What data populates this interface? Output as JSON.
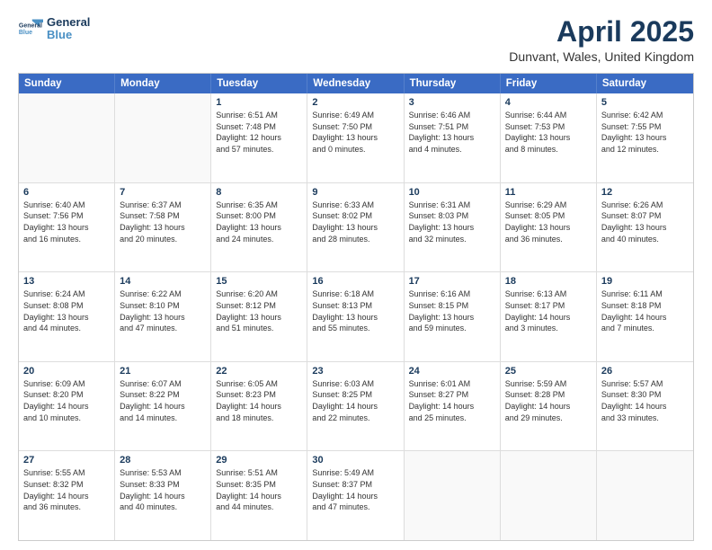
{
  "header": {
    "logo_line1": "General",
    "logo_line2": "Blue",
    "title": "April 2025",
    "subtitle": "Dunvant, Wales, United Kingdom"
  },
  "calendar": {
    "days_of_week": [
      "Sunday",
      "Monday",
      "Tuesday",
      "Wednesday",
      "Thursday",
      "Friday",
      "Saturday"
    ],
    "rows": [
      [
        {
          "day": "",
          "empty": true
        },
        {
          "day": "",
          "empty": true
        },
        {
          "day": "1",
          "line1": "Sunrise: 6:51 AM",
          "line2": "Sunset: 7:48 PM",
          "line3": "Daylight: 12 hours",
          "line4": "and 57 minutes."
        },
        {
          "day": "2",
          "line1": "Sunrise: 6:49 AM",
          "line2": "Sunset: 7:50 PM",
          "line3": "Daylight: 13 hours",
          "line4": "and 0 minutes."
        },
        {
          "day": "3",
          "line1": "Sunrise: 6:46 AM",
          "line2": "Sunset: 7:51 PM",
          "line3": "Daylight: 13 hours",
          "line4": "and 4 minutes."
        },
        {
          "day": "4",
          "line1": "Sunrise: 6:44 AM",
          "line2": "Sunset: 7:53 PM",
          "line3": "Daylight: 13 hours",
          "line4": "and 8 minutes."
        },
        {
          "day": "5",
          "line1": "Sunrise: 6:42 AM",
          "line2": "Sunset: 7:55 PM",
          "line3": "Daylight: 13 hours",
          "line4": "and 12 minutes."
        }
      ],
      [
        {
          "day": "6",
          "line1": "Sunrise: 6:40 AM",
          "line2": "Sunset: 7:56 PM",
          "line3": "Daylight: 13 hours",
          "line4": "and 16 minutes."
        },
        {
          "day": "7",
          "line1": "Sunrise: 6:37 AM",
          "line2": "Sunset: 7:58 PM",
          "line3": "Daylight: 13 hours",
          "line4": "and 20 minutes."
        },
        {
          "day": "8",
          "line1": "Sunrise: 6:35 AM",
          "line2": "Sunset: 8:00 PM",
          "line3": "Daylight: 13 hours",
          "line4": "and 24 minutes."
        },
        {
          "day": "9",
          "line1": "Sunrise: 6:33 AM",
          "line2": "Sunset: 8:02 PM",
          "line3": "Daylight: 13 hours",
          "line4": "and 28 minutes."
        },
        {
          "day": "10",
          "line1": "Sunrise: 6:31 AM",
          "line2": "Sunset: 8:03 PM",
          "line3": "Daylight: 13 hours",
          "line4": "and 32 minutes."
        },
        {
          "day": "11",
          "line1": "Sunrise: 6:29 AM",
          "line2": "Sunset: 8:05 PM",
          "line3": "Daylight: 13 hours",
          "line4": "and 36 minutes."
        },
        {
          "day": "12",
          "line1": "Sunrise: 6:26 AM",
          "line2": "Sunset: 8:07 PM",
          "line3": "Daylight: 13 hours",
          "line4": "and 40 minutes."
        }
      ],
      [
        {
          "day": "13",
          "line1": "Sunrise: 6:24 AM",
          "line2": "Sunset: 8:08 PM",
          "line3": "Daylight: 13 hours",
          "line4": "and 44 minutes."
        },
        {
          "day": "14",
          "line1": "Sunrise: 6:22 AM",
          "line2": "Sunset: 8:10 PM",
          "line3": "Daylight: 13 hours",
          "line4": "and 47 minutes."
        },
        {
          "day": "15",
          "line1": "Sunrise: 6:20 AM",
          "line2": "Sunset: 8:12 PM",
          "line3": "Daylight: 13 hours",
          "line4": "and 51 minutes."
        },
        {
          "day": "16",
          "line1": "Sunrise: 6:18 AM",
          "line2": "Sunset: 8:13 PM",
          "line3": "Daylight: 13 hours",
          "line4": "and 55 minutes."
        },
        {
          "day": "17",
          "line1": "Sunrise: 6:16 AM",
          "line2": "Sunset: 8:15 PM",
          "line3": "Daylight: 13 hours",
          "line4": "and 59 minutes."
        },
        {
          "day": "18",
          "line1": "Sunrise: 6:13 AM",
          "line2": "Sunset: 8:17 PM",
          "line3": "Daylight: 14 hours",
          "line4": "and 3 minutes."
        },
        {
          "day": "19",
          "line1": "Sunrise: 6:11 AM",
          "line2": "Sunset: 8:18 PM",
          "line3": "Daylight: 14 hours",
          "line4": "and 7 minutes."
        }
      ],
      [
        {
          "day": "20",
          "line1": "Sunrise: 6:09 AM",
          "line2": "Sunset: 8:20 PM",
          "line3": "Daylight: 14 hours",
          "line4": "and 10 minutes."
        },
        {
          "day": "21",
          "line1": "Sunrise: 6:07 AM",
          "line2": "Sunset: 8:22 PM",
          "line3": "Daylight: 14 hours",
          "line4": "and 14 minutes."
        },
        {
          "day": "22",
          "line1": "Sunrise: 6:05 AM",
          "line2": "Sunset: 8:23 PM",
          "line3": "Daylight: 14 hours",
          "line4": "and 18 minutes."
        },
        {
          "day": "23",
          "line1": "Sunrise: 6:03 AM",
          "line2": "Sunset: 8:25 PM",
          "line3": "Daylight: 14 hours",
          "line4": "and 22 minutes."
        },
        {
          "day": "24",
          "line1": "Sunrise: 6:01 AM",
          "line2": "Sunset: 8:27 PM",
          "line3": "Daylight: 14 hours",
          "line4": "and 25 minutes."
        },
        {
          "day": "25",
          "line1": "Sunrise: 5:59 AM",
          "line2": "Sunset: 8:28 PM",
          "line3": "Daylight: 14 hours",
          "line4": "and 29 minutes."
        },
        {
          "day": "26",
          "line1": "Sunrise: 5:57 AM",
          "line2": "Sunset: 8:30 PM",
          "line3": "Daylight: 14 hours",
          "line4": "and 33 minutes."
        }
      ],
      [
        {
          "day": "27",
          "line1": "Sunrise: 5:55 AM",
          "line2": "Sunset: 8:32 PM",
          "line3": "Daylight: 14 hours",
          "line4": "and 36 minutes."
        },
        {
          "day": "28",
          "line1": "Sunrise: 5:53 AM",
          "line2": "Sunset: 8:33 PM",
          "line3": "Daylight: 14 hours",
          "line4": "and 40 minutes."
        },
        {
          "day": "29",
          "line1": "Sunrise: 5:51 AM",
          "line2": "Sunset: 8:35 PM",
          "line3": "Daylight: 14 hours",
          "line4": "and 44 minutes."
        },
        {
          "day": "30",
          "line1": "Sunrise: 5:49 AM",
          "line2": "Sunset: 8:37 PM",
          "line3": "Daylight: 14 hours",
          "line4": "and 47 minutes."
        },
        {
          "day": "",
          "empty": true
        },
        {
          "day": "",
          "empty": true
        },
        {
          "day": "",
          "empty": true
        }
      ]
    ]
  }
}
